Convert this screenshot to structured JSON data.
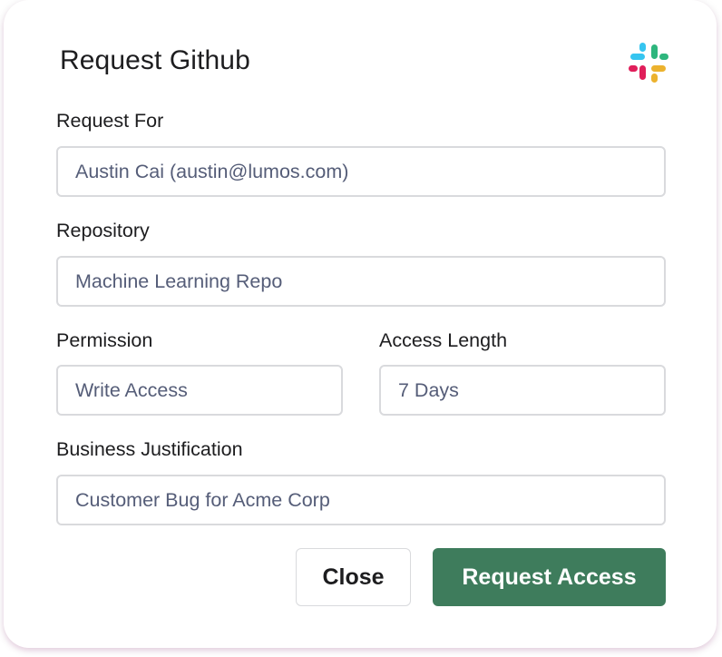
{
  "dialog": {
    "title": "Request Github",
    "logo_icon": "slack-logo-icon"
  },
  "form": {
    "request_for": {
      "label": "Request For",
      "value": "Austin Cai (austin@lumos.com)"
    },
    "repository": {
      "label": "Repository",
      "value": "Machine Learning Repo"
    },
    "permission": {
      "label": "Permission",
      "value": "Write Access"
    },
    "access_length": {
      "label": "Access Length",
      "value": "7 Days"
    },
    "business_justification": {
      "label": "Business Justification",
      "value": "Customer Bug for Acme Corp"
    }
  },
  "actions": {
    "close_label": "Close",
    "request_label": "Request Access"
  },
  "colors": {
    "primary_button": "#3e7c5c",
    "field_border": "#d9dadd",
    "field_text": "#555d78",
    "slack_blue": "#36c5f0",
    "slack_green": "#2eb67d",
    "slack_red": "#e01e5a",
    "slack_yellow": "#ecb22e"
  }
}
